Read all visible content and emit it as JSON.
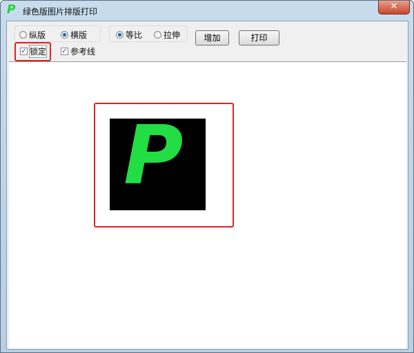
{
  "window": {
    "title": "绿色版图片排版打印",
    "logo": "P",
    "close_icon": "close-icon"
  },
  "toolbar": {
    "orientation": [
      {
        "label": "纵版",
        "selected": false
      },
      {
        "label": "横版",
        "selected": true
      }
    ],
    "scaling": [
      {
        "label": "等比",
        "selected": true
      },
      {
        "label": "拉伸",
        "selected": false
      }
    ],
    "add_label": "增加",
    "print_label": "打印",
    "lock": {
      "label": "锁定",
      "checked": true
    },
    "guides": {
      "label": "参考线",
      "checked": true
    }
  },
  "canvas": {
    "image_letter": "P"
  },
  "colors": {
    "highlight": "#e02020",
    "logo": "#22dd44"
  }
}
